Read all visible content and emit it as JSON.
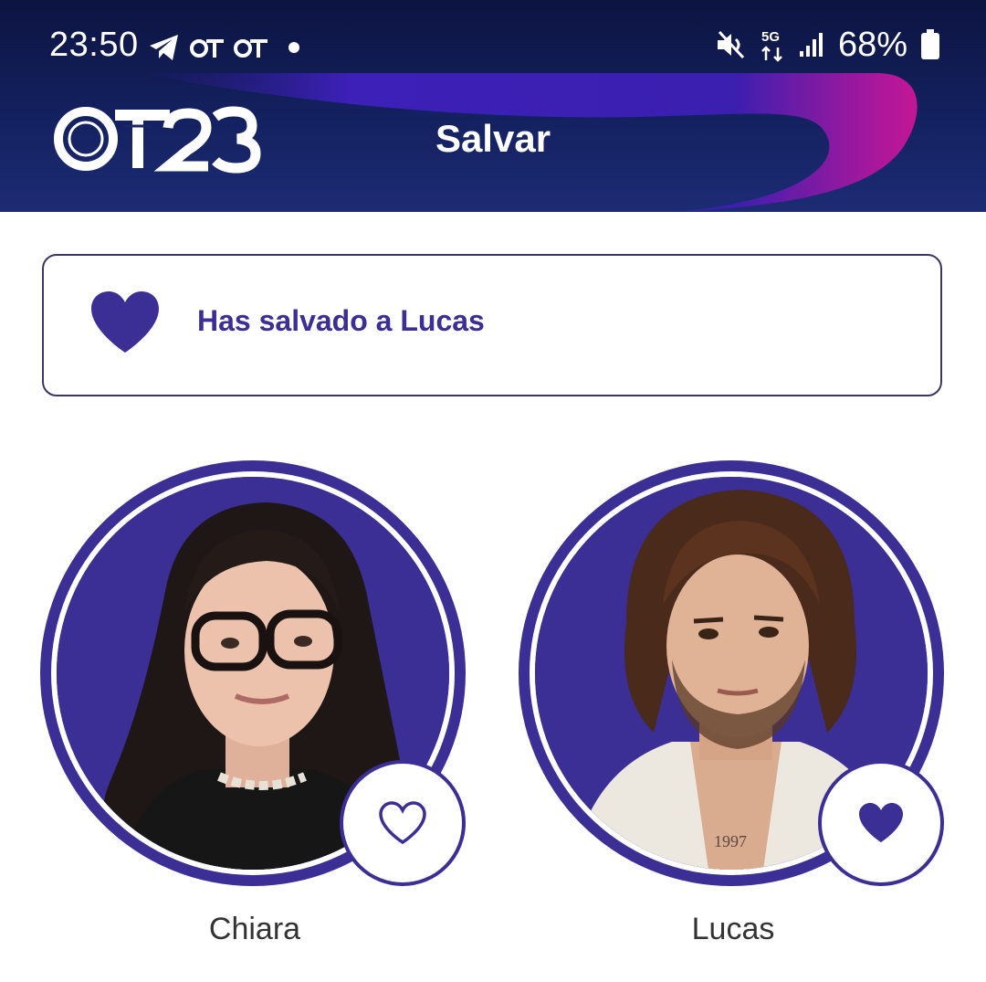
{
  "status_bar": {
    "time": "23:50",
    "battery_percent": "68%",
    "left_icons": [
      "telegram-icon",
      "ot-notification-icon",
      "ot-notification-icon",
      "dot-icon"
    ],
    "right_icons": [
      "mute-icon",
      "5g-icon",
      "signal-icon",
      "battery-icon"
    ]
  },
  "header": {
    "logo_text": "OT23",
    "title": "Salvar"
  },
  "message": {
    "icon": "heart-filled-icon",
    "text": "Has salvado a Lucas"
  },
  "candidates": [
    {
      "name": "Chiara",
      "saved": false,
      "heart_icon": "heart-outline-icon"
    },
    {
      "name": "Lucas",
      "saved": true,
      "heart_icon": "heart-filled-icon"
    }
  ],
  "colors": {
    "accent": "#3b2e94",
    "header_bg": "#142160",
    "swoosh_start": "#3a1fb0",
    "swoosh_end": "#e0168c",
    "text_dark": "#333333"
  }
}
